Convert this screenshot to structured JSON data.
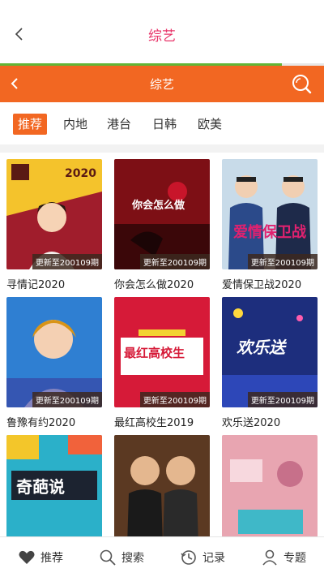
{
  "app_header": {
    "title": "综艺",
    "loading_progress": 0.87
  },
  "inner_header": {
    "title": "综艺"
  },
  "tabs": [
    {
      "label": "推荐",
      "active": true
    },
    {
      "label": "内地",
      "active": false
    },
    {
      "label": "港台",
      "active": false
    },
    {
      "label": "日韩",
      "active": false
    },
    {
      "label": "欧美",
      "active": false
    }
  ],
  "shows": [
    {
      "title": "寻情记2020",
      "badge": "更新至200109期",
      "poster_text": "2020"
    },
    {
      "title": "你会怎么做2020",
      "badge": "更新至200109期",
      "poster_text": "你会怎么做"
    },
    {
      "title": "爱情保卫战2020",
      "badge": "更新至200109期",
      "poster_text": "爱情保卫战"
    },
    {
      "title": "鲁豫有约2020",
      "badge": "更新至200109期",
      "poster_text": ""
    },
    {
      "title": "最红高校生2019",
      "badge": "更新至200109期",
      "poster_text": "最红高校生"
    },
    {
      "title": "欢乐送2020",
      "badge": "更新至200109期",
      "poster_text": "欢乐送"
    },
    {
      "title": "",
      "badge": "",
      "poster_text": "奇葩说"
    },
    {
      "title": "",
      "badge": "",
      "poster_text": ""
    },
    {
      "title": "",
      "badge": "",
      "poster_text": ""
    }
  ],
  "bottom_nav": [
    {
      "label": "推荐",
      "icon": "heart-icon"
    },
    {
      "label": "搜索",
      "icon": "search-icon"
    },
    {
      "label": "记录",
      "icon": "history-icon"
    },
    {
      "label": "专题",
      "icon": "user-icon"
    }
  ],
  "colors": {
    "accent": "#f26722",
    "title_pink": "#e8356a",
    "progress": "#62b536"
  }
}
